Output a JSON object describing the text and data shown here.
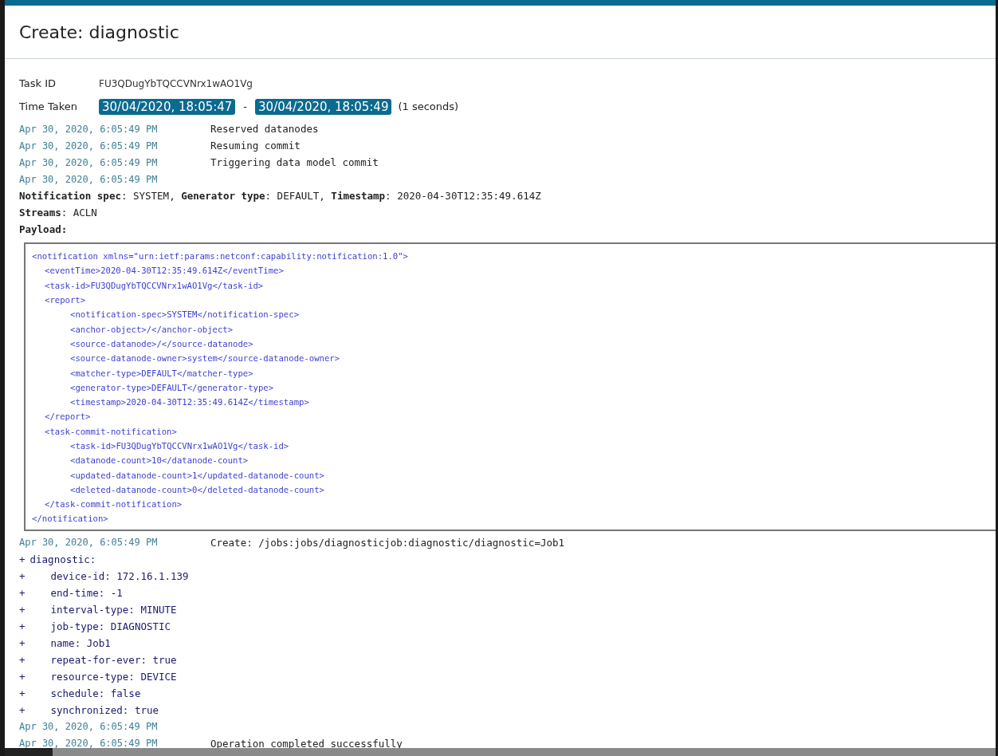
{
  "dialog": {
    "title": "Create: diagnostic"
  },
  "task": {
    "label": "Task ID",
    "value": "FU3QDugYbTQCCVNrx1wAO1Vg"
  },
  "time_taken": {
    "label": "Time Taken",
    "start": "30/04/2020, 18:05:47",
    "separator": "-",
    "end": "30/04/2020, 18:05:49",
    "duration": "(1 seconds)"
  },
  "log": [
    {
      "kind": "line",
      "time": "Apr 30, 2020, 6:05:49 PM",
      "message": "Reserved datanodes"
    },
    {
      "kind": "line",
      "time": "Apr 30, 2020, 6:05:49 PM",
      "message": "Resuming commit"
    },
    {
      "kind": "line",
      "time": "Apr 30, 2020, 6:05:49 PM",
      "message": "Triggering data model commit"
    },
    {
      "kind": "notification",
      "time": "Apr 30, 2020, 6:05:49 PM",
      "summary": "**Notification spec**: SYSTEM, **Generator type**: DEFAULT, **Timestamp**: 2020-04-30T12:35:49.614Z",
      "streams": "**Streams**: ACLN",
      "payload_label": "Payload:",
      "payload": [
        {
          "open": "<notification xmlns=\"urn:ietf:params:netconf:capability:notification:1.0\">",
          "close": "</notification>",
          "children": [
            {
              "open": "<eventTime>2020-04-30T12:35:49.614Z</eventTime>"
            },
            {
              "open": "<task-id>FU3QDugYbTQCCVNrx1wAO1Vg</task-id>"
            },
            {
              "open": "<report>",
              "close": "</report>",
              "children": [
                {
                  "open": "<notification-spec>SYSTEM</notification-spec>"
                },
                {
                  "open": "<anchor-object>/</anchor-object>"
                },
                {
                  "open": "<source-datanode>/</source-datanode>"
                },
                {
                  "open": "<source-datanode-owner>system</source-datanode-owner>"
                },
                {
                  "open": "<matcher-type>DEFAULT</matcher-type>"
                },
                {
                  "open": "<generator-type>DEFAULT</generator-type>"
                },
                {
                  "open": "<timestamp>2020-04-30T12:35:49.614Z</timestamp>"
                }
              ]
            },
            {
              "open": "<task-commit-notification>",
              "close": "</task-commit-notification>",
              "children": [
                {
                  "open": "<task-id>FU3QDugYbTQCCVNrx1wAO1Vg</task-id>"
                },
                {
                  "open": "<datanode-count>10</datanode-count>"
                },
                {
                  "open": "<updated-datanode-count>1</updated-datanode-count>"
                },
                {
                  "open": "<deleted-datanode-count>0</deleted-datanode-count>"
                }
              ]
            }
          ]
        }
      ]
    },
    {
      "kind": "diff",
      "time": "Apr 30, 2020, 6:05:49 PM",
      "message": "Create: /jobs:jobs/diagnosticjob:diagnostic/diagnostic=Job1",
      "tree": [
        {
          "marker": "+",
          "text": "diagnostic:",
          "children": [
            {
              "marker": "+",
              "text": "device-id: 172.16.1.139"
            },
            {
              "marker": "+",
              "text": "end-time: -1"
            },
            {
              "marker": "+",
              "text": "interval-type: MINUTE"
            },
            {
              "marker": "+",
              "text": "job-type: DIAGNOSTIC"
            },
            {
              "marker": "+",
              "text": "name: Job1"
            },
            {
              "marker": "+",
              "text": "repeat-for-ever: true"
            },
            {
              "marker": "+",
              "text": "resource-type: DEVICE"
            },
            {
              "marker": "+",
              "text": "schedule: false"
            },
            {
              "marker": "+",
              "text": "synchronized: true"
            }
          ]
        }
      ]
    },
    {
      "kind": "line",
      "time": "Apr 30, 2020, 6:05:49 PM"
    },
    {
      "kind": "line",
      "time": "Apr 30, 2020, 6:05:49 PM",
      "message": "Operation completed successfully"
    }
  ]
}
